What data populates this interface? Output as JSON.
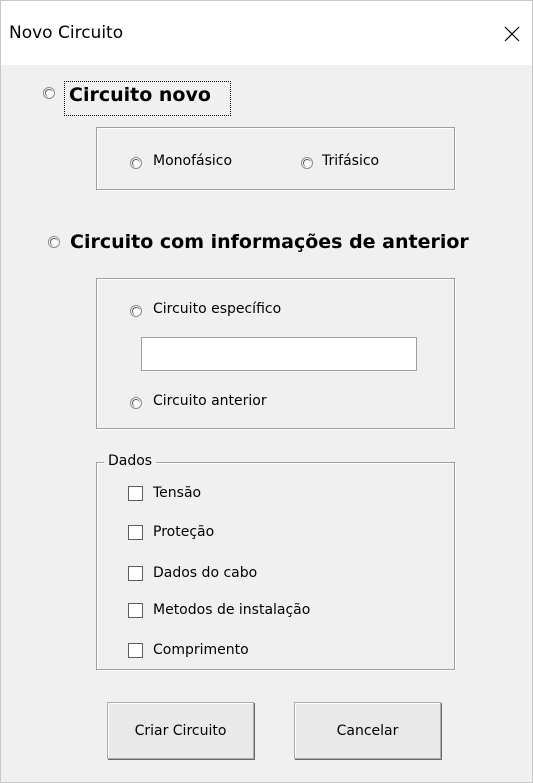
{
  "window": {
    "title": "Novo Circuito",
    "close_icon": "close-icon"
  },
  "option_new": {
    "label": "Circuito novo",
    "phase_options": [
      "Monofásico",
      "Trifásico"
    ]
  },
  "option_previous": {
    "label": "Circuito com informações de anterior",
    "specific_label": "Circuito específico",
    "specific_value": "",
    "previous_label": "Circuito anterior"
  },
  "data_group": {
    "legend": "Dados",
    "items": [
      "Tensão",
      "Proteção",
      "Dados do cabo",
      "Metodos de instalação",
      "Comprimento"
    ]
  },
  "buttons": {
    "create_label": "Criar Circuito",
    "cancel_label": "Cancelar"
  }
}
